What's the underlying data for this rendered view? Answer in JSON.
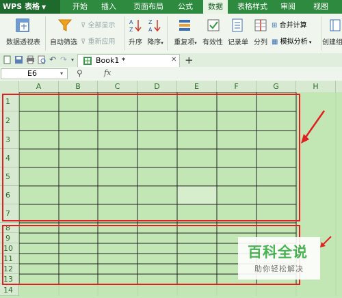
{
  "menubar": {
    "app_title": "WPS 表格",
    "tabs": [
      {
        "label": "开始"
      },
      {
        "label": "插入"
      },
      {
        "label": "页面布局"
      },
      {
        "label": "公式"
      },
      {
        "label": "数据"
      },
      {
        "label": "表格样式"
      },
      {
        "label": "审阅"
      },
      {
        "label": "视图"
      }
    ],
    "active_tab": "数据"
  },
  "ribbon": {
    "pivot_label": "数据透视表",
    "autofilter_label": "自动筛选",
    "show_all_label": "全部显示",
    "reapply_label": "重新应用",
    "sort_asc_label": "升序",
    "sort_desc_label": "降序",
    "duplicates_label": "重复项",
    "validity_label": "有效性",
    "record_label": "记录单",
    "split_label": "分列",
    "merge_calc_label": "合并计算",
    "whatif_label": "模拟分析",
    "create_group_label": "创建组"
  },
  "tabrow": {
    "document_tab": "Book1 *",
    "close_glyph": "✕",
    "new_tab_glyph": "+"
  },
  "formula_bar": {
    "cell_reference": "E6",
    "fx_label": "fx"
  },
  "sheet": {
    "columns": [
      "A",
      "B",
      "C",
      "D",
      "E",
      "F",
      "G",
      "H"
    ],
    "rows": [
      "1",
      "2",
      "3",
      "4",
      "5",
      "6",
      "7",
      "8",
      "9",
      "10",
      "11",
      "12",
      "13",
      "14"
    ]
  },
  "watermark": {
    "title": "百科全说",
    "subtitle": "助你轻松解决"
  },
  "colors": {
    "menu_green": "#2d8a3e",
    "grid_green": "#c2e6b4",
    "annotation_red": "#e02020"
  }
}
